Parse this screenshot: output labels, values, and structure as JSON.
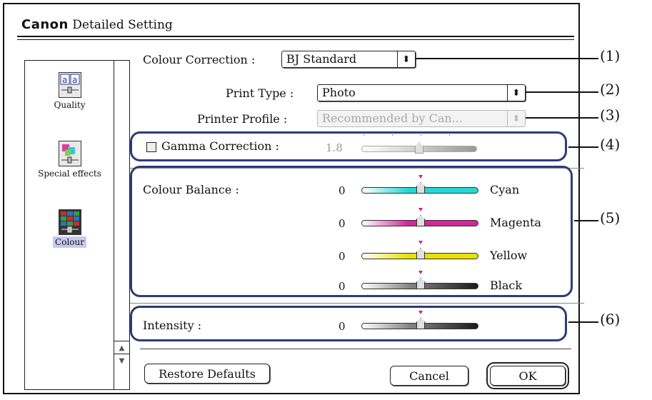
{
  "window": {
    "brand": "Canon",
    "title": "Detailed Setting"
  },
  "sidebar": {
    "items": [
      {
        "label": "Quality",
        "icon": "quality-icon",
        "selected": false
      },
      {
        "label": "Special effects",
        "icon": "special-effects-icon",
        "selected": false
      },
      {
        "label": "Colour",
        "icon": "colour-icon",
        "selected": true
      }
    ]
  },
  "colour_correction": {
    "label": "Colour Correction :",
    "value": "BJ Standard"
  },
  "print_type": {
    "label": "Print Type :",
    "value": "Photo"
  },
  "printer_profile": {
    "label": "Printer Profile :",
    "value": "Recommended by Can..."
  },
  "gamma": {
    "label": "Gamma Correction :",
    "value": "1.8",
    "checked": false
  },
  "colour_balance": {
    "label": "Colour Balance :",
    "sliders": [
      {
        "name": "Cyan",
        "value": "0",
        "color": "#27d6d6"
      },
      {
        "name": "Magenta",
        "value": "0",
        "color": "#d6249b"
      },
      {
        "name": "Yellow",
        "value": "0",
        "color": "#e8e000"
      },
      {
        "name": "Black",
        "value": "0",
        "color": "#1a1a1a"
      }
    ]
  },
  "intensity": {
    "label": "Intensity :",
    "value": "0"
  },
  "buttons": {
    "restore": "Restore Defaults",
    "cancel": "Cancel",
    "ok": "OK"
  },
  "callouts": [
    "(1)",
    "(2)",
    "(3)",
    "(4)",
    "(5)",
    "(6)"
  ],
  "colors": {
    "group_outline": "#2e3b7a",
    "selection": "#c9c9ee",
    "slider_marker": "#d0208a"
  }
}
